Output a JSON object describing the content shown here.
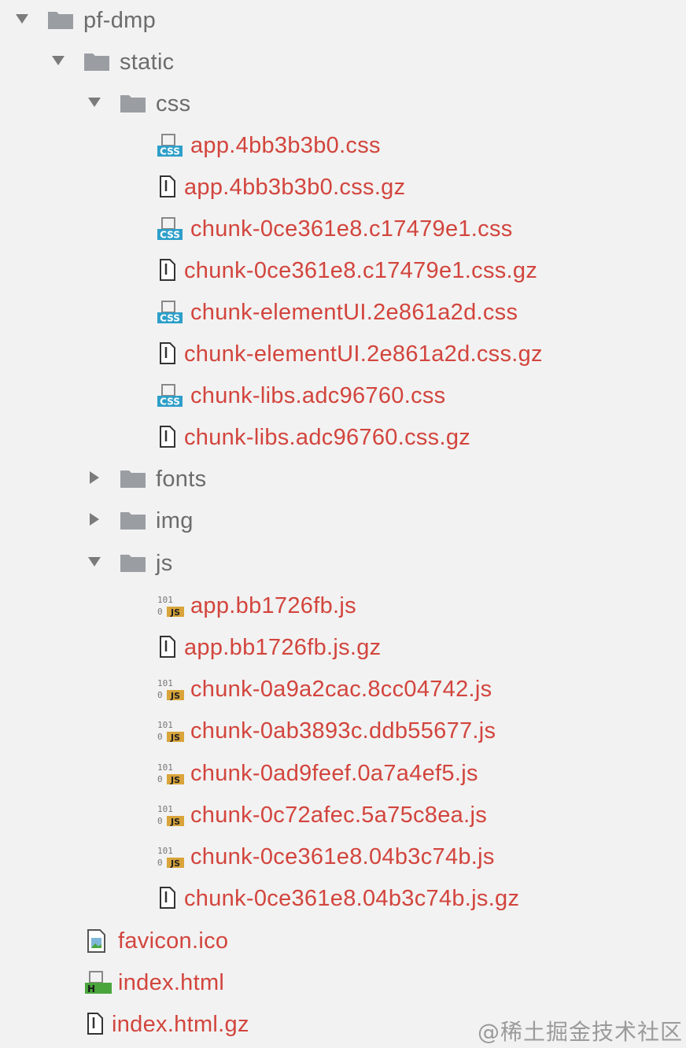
{
  "tree": {
    "root": "pf-dmp",
    "static": "static",
    "css": "css",
    "css_files": [
      "app.4bb3b3b0.css",
      "app.4bb3b3b0.css.gz",
      "chunk-0ce361e8.c17479e1.css",
      "chunk-0ce361e8.c17479e1.css.gz",
      "chunk-elementUI.2e861a2d.css",
      "chunk-elementUI.2e861a2d.css.gz",
      "chunk-libs.adc96760.css",
      "chunk-libs.adc96760.css.gz"
    ],
    "css_file_icons": [
      "css-file-icon",
      "text-file-icon",
      "css-file-icon",
      "text-file-icon",
      "css-file-icon",
      "text-file-icon",
      "css-file-icon",
      "text-file-icon"
    ],
    "fonts": "fonts",
    "img": "img",
    "js": "js",
    "js_files": [
      "app.bb1726fb.js",
      "app.bb1726fb.js.gz",
      "chunk-0a9a2cac.8cc04742.js",
      "chunk-0ab3893c.ddb55677.js",
      "chunk-0ad9feef.0a7a4ef5.js",
      "chunk-0c72afec.5a75c8ea.js",
      "chunk-0ce361e8.04b3c74b.js",
      "chunk-0ce361e8.04b3c74b.js.gz"
    ],
    "js_file_icons": [
      "js-file-icon",
      "text-file-icon",
      "js-file-icon",
      "js-file-icon",
      "js-file-icon",
      "js-file-icon",
      "js-file-icon",
      "text-file-icon"
    ],
    "root_files": [
      "favicon.ico",
      "index.html",
      "index.html.gz"
    ],
    "root_file_icons": [
      "image-file-icon",
      "html-file-icon",
      "text-file-icon"
    ]
  },
  "icon_text": {
    "css": "CSS",
    "js": "JS",
    "bin": "101\n0",
    "html": "H"
  },
  "colors": {
    "folder": "#9a9ea3",
    "file_text": "#d2453d",
    "dir_text": "#6c6c6c",
    "css_badge": "#2e9fc9",
    "js_badge": "#d9a43a",
    "html_badge": "#4aa63c"
  },
  "watermark": "@稀土掘金技术社区"
}
